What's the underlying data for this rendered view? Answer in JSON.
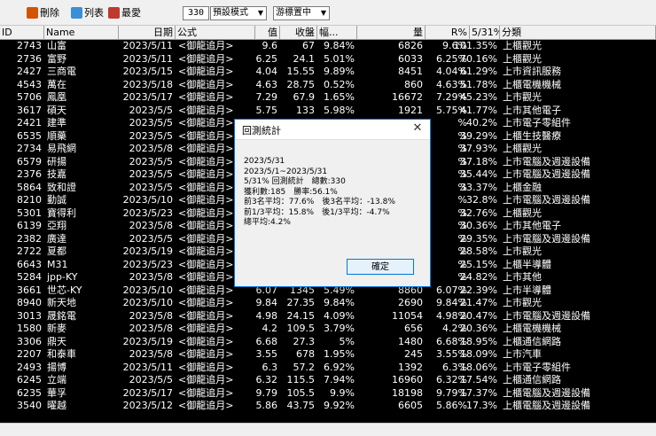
{
  "toolbar": {
    "delete_label": "刪除",
    "list_label": "列表",
    "fav_label": "最愛",
    "count_value": "330",
    "mode_select": "預設模式",
    "cursor_select": "游標置中"
  },
  "headers": [
    "ID",
    "Name",
    "日期",
    "公式",
    "值",
    "收盤",
    "幅...",
    "量",
    "R%",
    "5/31%",
    "分類"
  ],
  "rows": [
    [
      "2743",
      "山富",
      "2023/5/11",
      "<御龍追月>",
      "9.6",
      "67",
      "9.84%",
      "6826",
      "9.6%",
      "101.35%",
      "上櫃觀光"
    ],
    [
      "2736",
      "富野",
      "2023/5/11",
      "<御龍追月>",
      "6.25",
      "24.1",
      "5.01%",
      "6033",
      "6.25%",
      "70.16%",
      "上櫃觀光"
    ],
    [
      "2427",
      "三商電",
      "2023/5/15",
      "<御龍追月>",
      "4.04",
      "15.55",
      "9.89%",
      "8451",
      "4.04%",
      "61.29%",
      "上市資訊服務"
    ],
    [
      "4543",
      "萬在",
      "2023/5/18",
      "<御龍追月>",
      "4.63",
      "28.75",
      "0.52%",
      "860",
      "4.63%",
      "51.78%",
      "上櫃電機機械"
    ],
    [
      "5706",
      "鳳凰",
      "2023/5/17",
      "<御龍追月>",
      "7.29",
      "67.9",
      "1.65%",
      "16672",
      "7.29%",
      "45.23%",
      "上市觀光"
    ],
    [
      "3617",
      "碩天",
      "2023/5/5",
      "<御龍追月>",
      "5.75",
      "133",
      "5.98%",
      "1921",
      "5.75%",
      "41.77%",
      "上市其他電子"
    ],
    [
      "2421",
      "建準",
      "2023/5/5",
      "<御龍追月>",
      "",
      "",
      "",
      "",
      "%",
      "40.2%",
      "上市電子零組件"
    ],
    [
      "6535",
      "順藥",
      "2023/5/5",
      "<御龍追月>",
      "",
      "",
      "",
      "",
      "%",
      "39.29%",
      "上櫃生技醫療"
    ],
    [
      "2734",
      "易飛網",
      "2023/5/8",
      "<御龍追月>",
      "",
      "",
      "",
      "",
      "%",
      "37.93%",
      "上櫃觀光"
    ],
    [
      "6579",
      "研揚",
      "2023/5/5",
      "<御龍追月>",
      "",
      "",
      "",
      "",
      "%",
      "37.18%",
      "上市電腦及週邊設備"
    ],
    [
      "2376",
      "技嘉",
      "2023/5/5",
      "<御龍追月>",
      "",
      "",
      "",
      "",
      "%",
      "35.44%",
      "上市電腦及週邊設備"
    ],
    [
      "5864",
      "致和證",
      "2023/5/5",
      "<御龍追月>",
      "",
      "",
      "",
      "",
      "%",
      "33.37%",
      "上櫃金融"
    ],
    [
      "8210",
      "勤誠",
      "2023/5/10",
      "<御龍追月>",
      "",
      "",
      "",
      "",
      "%",
      "32.8%",
      "上市電腦及週邊設備"
    ],
    [
      "5301",
      "寶得利",
      "2023/5/23",
      "<御龍追月>",
      "",
      "",
      "",
      "",
      "%",
      "32.76%",
      "上櫃觀光"
    ],
    [
      "6139",
      "亞翔",
      "2023/5/8",
      "<御龍追月>",
      "",
      "",
      "",
      "",
      "%",
      "30.36%",
      "上市其他電子"
    ],
    [
      "2382",
      "廣達",
      "2023/5/5",
      "<御龍追月>",
      "",
      "",
      "",
      "",
      "%",
      "29.35%",
      "上市電腦及週邊設備"
    ],
    [
      "2722",
      "夏都",
      "2023/5/19",
      "<御龍追月>",
      "",
      "",
      "",
      "",
      "%",
      "28.58%",
      "上市觀光"
    ],
    [
      "6643",
      "M31",
      "2023/5/23",
      "<御龍追月>",
      "",
      "",
      "",
      "",
      "%",
      "25.15%",
      "上櫃半導體"
    ],
    [
      "5284",
      "jpp-KY",
      "2023/5/8",
      "<御龍追月>",
      "",
      "",
      "",
      "",
      "%",
      "24.82%",
      "上市其他"
    ],
    [
      "3661",
      "世芯-KY",
      "2023/5/10",
      "<御龍追月>",
      "6.07",
      "1345",
      "5.49%",
      "8860",
      "6.07%",
      "22.39%",
      "上市半導體"
    ],
    [
      "8940",
      "新天地",
      "2023/5/10",
      "<御龍追月>",
      "9.84",
      "27.35",
      "9.84%",
      "2690",
      "9.84%",
      "21.47%",
      "上市觀光"
    ],
    [
      "3013",
      "晟銘電",
      "2023/5/8",
      "<御龍追月>",
      "4.98",
      "24.15",
      "4.09%",
      "11054",
      "4.98%",
      "20.47%",
      "上市電腦及週邊設備"
    ],
    [
      "1580",
      "新麥",
      "2023/5/8",
      "<御龍追月>",
      "4.2",
      "109.5",
      "3.79%",
      "656",
      "4.2%",
      "20.36%",
      "上櫃電機機械"
    ],
    [
      "3306",
      "鼎天",
      "2023/5/19",
      "<御龍追月>",
      "6.68",
      "27.3",
      "5%",
      "1480",
      "6.68%",
      "18.95%",
      "上櫃通信網路"
    ],
    [
      "2207",
      "和泰車",
      "2023/5/8",
      "<御龍追月>",
      "3.55",
      "678",
      "1.95%",
      "245",
      "3.55%",
      "18.09%",
      "上市汽車"
    ],
    [
      "2493",
      "揚博",
      "2023/5/11",
      "<御龍追月>",
      "6.3",
      "57.2",
      "6.92%",
      "1392",
      "6.3%",
      "18.06%",
      "上市電子零組件"
    ],
    [
      "6245",
      "立端",
      "2023/5/5",
      "<御龍追月>",
      "6.32",
      "115.5",
      "7.94%",
      "16960",
      "6.32%",
      "17.54%",
      "上櫃通信網路"
    ],
    [
      "6235",
      "華孚",
      "2023/5/17",
      "<御龍追月>",
      "9.79",
      "105.5",
      "9.9%",
      "18198",
      "9.79%",
      "17.37%",
      "上櫃電腦及週邊設備"
    ],
    [
      "3540",
      "曜越",
      "2023/5/12",
      "<御龍追月>",
      "5.86",
      "43.75",
      "9.92%",
      "6605",
      "5.86%",
      "17.3%",
      "上櫃電腦及週邊設備"
    ]
  ],
  "dialog": {
    "title": "回測統計",
    "lines": [
      "2023/5/31",
      "2023/5/1~2023/5/31",
      "5/31% 回測統計　總數:330",
      "獲利數:185　勝率:56.1%",
      "前3名平均：77.6%　後3名平均：-13.8%",
      "前1/3平均：15.8%　後1/3平均：-4.7%",
      "總平均:4.2%"
    ],
    "ok_label": "確定"
  }
}
